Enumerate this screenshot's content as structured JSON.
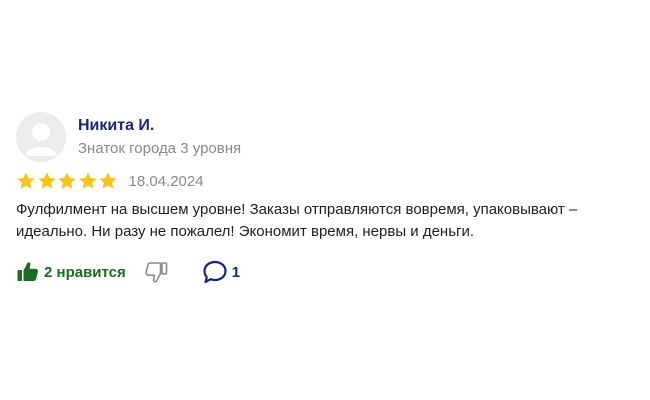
{
  "review": {
    "author_name": "Никита И.",
    "author_level": "Знаток города 3 уровня",
    "rating": 5,
    "rating_max": 5,
    "date": "18.04.2024",
    "text": "Фулфилмент на высшем уровне! Заказы отправляются вовремя, упаковывают – идеально. Ни разу не пожалел! Экономит время, нервы и деньги.",
    "likes_label": "2 нравится",
    "comments_count": "1"
  },
  "colors": {
    "star": "#f5c518",
    "like": "#1d6b1f",
    "accent": "#1a237e",
    "muted": "#8a8a8a"
  },
  "icons": {
    "avatar": "default-avatar-icon",
    "star": "star-icon",
    "like": "thumbs-up-icon",
    "dislike": "thumbs-down-icon",
    "comment": "comment-bubble-icon"
  }
}
